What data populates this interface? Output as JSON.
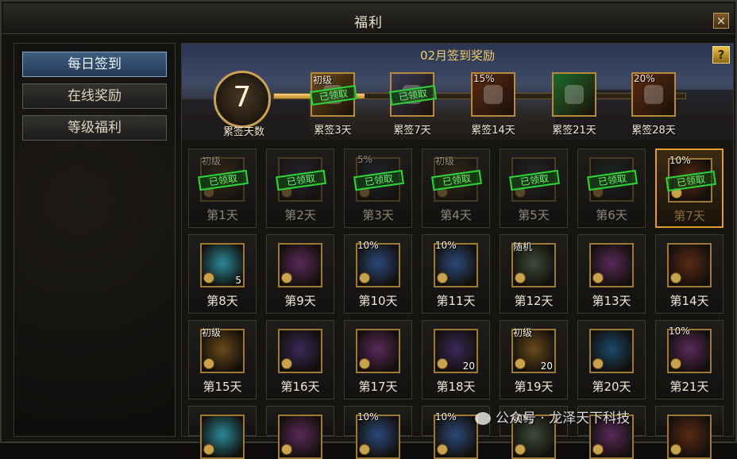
{
  "window": {
    "title": "福利",
    "close": "×"
  },
  "sidebar": {
    "items": [
      {
        "label": "每日签到",
        "active": true
      },
      {
        "label": "在线奖励",
        "active": false
      },
      {
        "label": "等级福利",
        "active": false
      }
    ]
  },
  "banner": {
    "title": "02月签到奖励",
    "help": "?",
    "days_signed": "7",
    "days_label": "累签天数",
    "progress_fraction": 0.22,
    "milestones": [
      {
        "label": "累签3天",
        "tag": "初级",
        "claimed": true,
        "stamp": "已领取",
        "icon": "potion-gold-icon",
        "color": "#6a4a1c"
      },
      {
        "label": "累签7天",
        "tag": "",
        "claimed": true,
        "stamp": "已领取",
        "icon": "ore-icon",
        "color": "#3a3a55"
      },
      {
        "label": "累签14天",
        "tag": "15%",
        "claimed": false,
        "stamp": "",
        "icon": "potion-white-icon",
        "color": "#5a2a14"
      },
      {
        "label": "累签21天",
        "tag": "",
        "claimed": false,
        "stamp": "",
        "icon": "jade-gem-icon",
        "color": "#1e6a2a"
      },
      {
        "label": "累签28天",
        "tag": "20%",
        "claimed": false,
        "stamp": "",
        "icon": "potion-white-icon",
        "color": "#5a2a14"
      }
    ]
  },
  "grid": {
    "rows": [
      [
        {
          "label": "第1天",
          "tag": "初级",
          "qty": "",
          "state": "claimed",
          "stamp": "已领取",
          "icon": "potion-gold-icon",
          "color": "#6a4a1c"
        },
        {
          "label": "第2天",
          "tag": "",
          "qty": "",
          "state": "claimed",
          "stamp": "已领取",
          "icon": "ore-icon",
          "color": "#3a3a55"
        },
        {
          "label": "第3天",
          "tag": "5%",
          "qty": "",
          "state": "claimed",
          "stamp": "已领取",
          "icon": "scroll-icon",
          "color": "#2a3a5a"
        },
        {
          "label": "第4天",
          "tag": "初级",
          "qty": "",
          "state": "claimed",
          "stamp": "已领取",
          "icon": "potion-gold-icon",
          "color": "#6a4a1c"
        },
        {
          "label": "第5天",
          "tag": "",
          "qty": "",
          "state": "claimed",
          "stamp": "已领取",
          "icon": "ore-icon",
          "color": "#3a3a55"
        },
        {
          "label": "第6天",
          "tag": "",
          "qty": "",
          "state": "claimed",
          "stamp": "已领取",
          "icon": "firework-icon",
          "color": "#1a4a3a"
        },
        {
          "label": "第7天",
          "tag": "10%",
          "qty": "",
          "state": "current",
          "stamp": "已领取",
          "icon": "potion-white-icon",
          "color": "#5a2a14"
        }
      ],
      [
        {
          "label": "第8天",
          "tag": "",
          "qty": "5",
          "state": "open",
          "stamp": "",
          "icon": "map-scroll-icon",
          "color": "#2a8a9a"
        },
        {
          "label": "第9天",
          "tag": "",
          "qty": "",
          "state": "open",
          "stamp": "",
          "icon": "orange-potion-icon",
          "color": "#5a2a5a"
        },
        {
          "label": "第10天",
          "tag": "10%",
          "qty": "",
          "state": "open",
          "stamp": "",
          "icon": "scroll-icon",
          "color": "#2a4a7a"
        },
        {
          "label": "第11天",
          "tag": "10%",
          "qty": "",
          "state": "open",
          "stamp": "",
          "icon": "scroll-icon",
          "color": "#2a4a7a"
        },
        {
          "label": "第12天",
          "tag": "随机",
          "qty": "",
          "state": "open",
          "stamp": "",
          "icon": "book-icon",
          "color": "#3a4a3a"
        },
        {
          "label": "第13天",
          "tag": "",
          "qty": "",
          "state": "open",
          "stamp": "",
          "icon": "blue-orb-icon",
          "color": "#5a2a5a"
        },
        {
          "label": "第14天",
          "tag": "",
          "qty": "",
          "state": "open",
          "stamp": "",
          "icon": "scroll-bundle-icon",
          "color": "#5a2a14"
        }
      ],
      [
        {
          "label": "第15天",
          "tag": "初级",
          "qty": "",
          "state": "open",
          "stamp": "",
          "icon": "potion-gold-icon",
          "color": "#6a4a1c"
        },
        {
          "label": "第16天",
          "tag": "",
          "qty": "",
          "state": "open",
          "stamp": "",
          "icon": "ore-icon",
          "color": "#3a2a5a"
        },
        {
          "label": "第17天",
          "tag": "",
          "qty": "",
          "state": "open",
          "stamp": "",
          "icon": "red-pouch-icon",
          "color": "#5a2a5a"
        },
        {
          "label": "第18天",
          "tag": "",
          "qty": "20",
          "state": "open",
          "stamp": "",
          "icon": "scroll-bundle-icon",
          "color": "#3a2a5a"
        },
        {
          "label": "第19天",
          "tag": "初级",
          "qty": "20",
          "state": "open",
          "stamp": "",
          "icon": "potion-gold-icon",
          "color": "#6a4a1c"
        },
        {
          "label": "第20天",
          "tag": "",
          "qty": "",
          "state": "open",
          "stamp": "",
          "icon": "firework-icon",
          "color": "#1a4a6a"
        },
        {
          "label": "第21天",
          "tag": "10%",
          "qty": "",
          "state": "open",
          "stamp": "",
          "icon": "potion-white-icon",
          "color": "#5a2a5a"
        }
      ],
      [
        {
          "label": "",
          "tag": "",
          "qty": "",
          "state": "open",
          "stamp": "",
          "icon": "map-scroll-icon",
          "color": "#2a8a9a"
        },
        {
          "label": "",
          "tag": "",
          "qty": "",
          "state": "open",
          "stamp": "",
          "icon": "orange-potion-icon",
          "color": "#5a2a5a"
        },
        {
          "label": "",
          "tag": "10%",
          "qty": "",
          "state": "open",
          "stamp": "",
          "icon": "scroll-icon",
          "color": "#2a4a7a"
        },
        {
          "label": "",
          "tag": "10%",
          "qty": "",
          "state": "open",
          "stamp": "",
          "icon": "scroll-icon",
          "color": "#2a4a7a"
        },
        {
          "label": "",
          "tag": "随机",
          "qty": "",
          "state": "open",
          "stamp": "",
          "icon": "book-icon",
          "color": "#3a4a3a"
        },
        {
          "label": "",
          "tag": "",
          "qty": "",
          "state": "open",
          "stamp": "",
          "icon": "blue-orb-icon",
          "color": "#5a2a5a"
        },
        {
          "label": "",
          "tag": "",
          "qty": "",
          "state": "open",
          "stamp": "",
          "icon": "scroll-bundle-icon",
          "color": "#5a2a14"
        }
      ]
    ]
  },
  "watermark": {
    "text": "公众号 · 龙泽天下科技",
    "icon": "wechat-icon"
  }
}
